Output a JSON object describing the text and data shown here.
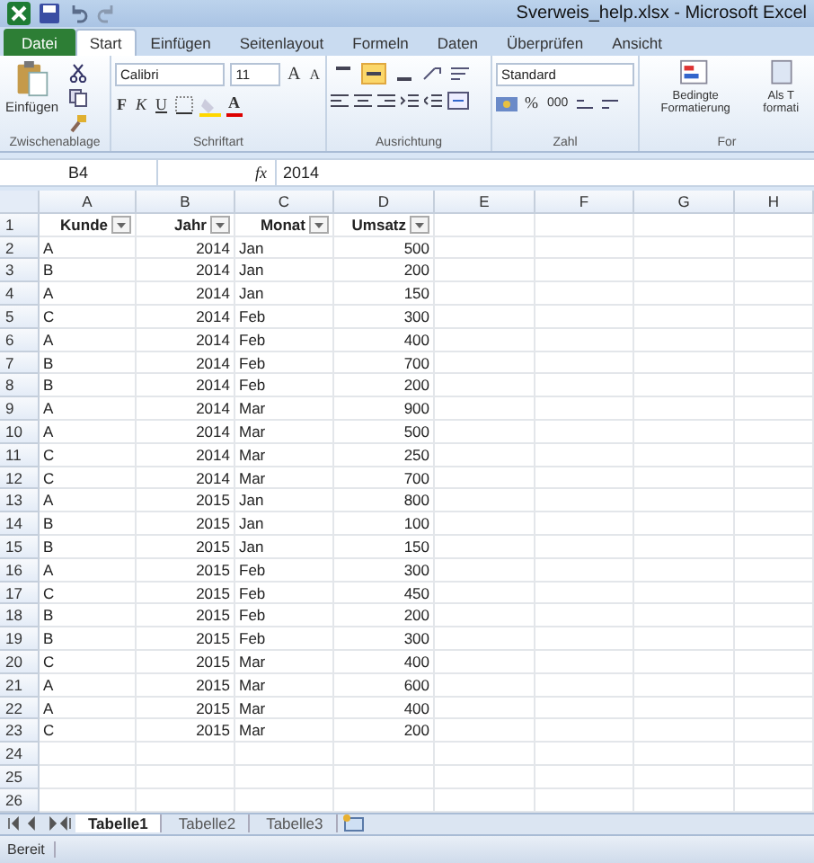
{
  "window": {
    "title": "Sverweis_help.xlsx - Microsoft Excel"
  },
  "ribbon_tabs": [
    {
      "label": "Datei",
      "kind": "file",
      "selected": false
    },
    {
      "label": "Start",
      "kind": "tab",
      "selected": true
    },
    {
      "label": "Einfügen",
      "kind": "tab",
      "selected": false
    },
    {
      "label": "Seitenlayout",
      "kind": "tab",
      "selected": false
    },
    {
      "label": "Formeln",
      "kind": "tab",
      "selected": false
    },
    {
      "label": "Daten",
      "kind": "tab",
      "selected": false
    },
    {
      "label": "Überprüfen",
      "kind": "tab",
      "selected": false
    },
    {
      "label": "Ansicht",
      "kind": "tab",
      "selected": false
    }
  ],
  "ribbon": {
    "clipboard": {
      "paste_label": "Einfügen",
      "group_label": "Zwischenablage"
    },
    "font": {
      "family": "Calibri",
      "size": "11",
      "grow": "A",
      "shrink": "A",
      "bold": "F",
      "italic": "K",
      "underline": "U",
      "font_color": "A",
      "group_label": "Schriftart"
    },
    "alignment": {
      "vertical": [
        {
          "selected": false
        },
        {
          "selected": true
        },
        {
          "selected": false
        }
      ],
      "group_label": "Ausrichtung"
    },
    "number": {
      "format": "Standard",
      "percent": "%",
      "thousands": "000",
      "group_label": "Zahl"
    },
    "styles": {
      "conditional_label": "Bedingte Formatierung",
      "table_label": "Als T formati",
      "group_label": "For"
    }
  },
  "formula_bar": {
    "name_box": "B4",
    "fx": "fx",
    "value": "2014"
  },
  "sheet": {
    "columns": [
      {
        "letter": "A",
        "kind": "text"
      },
      {
        "letter": "B",
        "kind": "number"
      },
      {
        "letter": "C",
        "kind": "text"
      },
      {
        "letter": "D",
        "kind": "number"
      },
      {
        "letter": "E",
        "kind": "text"
      },
      {
        "letter": "F",
        "kind": "text"
      },
      {
        "letter": "G",
        "kind": "text"
      },
      {
        "letter": "H",
        "kind": "text"
      }
    ],
    "rows": [
      {
        "number": "1",
        "kind": "header",
        "cells": [
          "Kunde",
          "Jahr",
          "Monat",
          "Umsatz"
        ]
      },
      {
        "number": "2",
        "kind": "data",
        "cells": [
          "A",
          "2014",
          "Jan",
          "500"
        ]
      },
      {
        "number": "3",
        "kind": "data",
        "cells": [
          "B",
          "2014",
          "Jan",
          "200"
        ]
      },
      {
        "number": "4",
        "kind": "data",
        "cells": [
          "A",
          "2014",
          "Jan",
          "150"
        ]
      },
      {
        "number": "5",
        "kind": "data",
        "cells": [
          "C",
          "2014",
          "Feb",
          "300"
        ]
      },
      {
        "number": "6",
        "kind": "data",
        "cells": [
          "A",
          "2014",
          "Feb",
          "400"
        ]
      },
      {
        "number": "7",
        "kind": "data",
        "cells": [
          "B",
          "2014",
          "Feb",
          "700"
        ]
      },
      {
        "number": "8",
        "kind": "data",
        "cells": [
          "B",
          "2014",
          "Feb",
          "200"
        ]
      },
      {
        "number": "9",
        "kind": "data",
        "cells": [
          "A",
          "2014",
          "Mar",
          "900"
        ]
      },
      {
        "number": "10",
        "kind": "data",
        "cells": [
          "A",
          "2014",
          "Mar",
          "500"
        ]
      },
      {
        "number": "11",
        "kind": "data",
        "cells": [
          "C",
          "2014",
          "Mar",
          "250"
        ]
      },
      {
        "number": "12",
        "kind": "data",
        "cells": [
          "C",
          "2014",
          "Mar",
          "700"
        ]
      },
      {
        "number": "13",
        "kind": "data",
        "cells": [
          "A",
          "2015",
          "Jan",
          "800"
        ]
      },
      {
        "number": "14",
        "kind": "data",
        "cells": [
          "B",
          "2015",
          "Jan",
          "100"
        ]
      },
      {
        "number": "15",
        "kind": "data",
        "cells": [
          "B",
          "2015",
          "Jan",
          "150"
        ]
      },
      {
        "number": "16",
        "kind": "data",
        "cells": [
          "A",
          "2015",
          "Feb",
          "300"
        ]
      },
      {
        "number": "17",
        "kind": "data",
        "cells": [
          "C",
          "2015",
          "Feb",
          "450"
        ]
      },
      {
        "number": "18",
        "kind": "data",
        "cells": [
          "B",
          "2015",
          "Feb",
          "200"
        ]
      },
      {
        "number": "19",
        "kind": "data",
        "cells": [
          "B",
          "2015",
          "Feb",
          "300"
        ]
      },
      {
        "number": "20",
        "kind": "data",
        "cells": [
          "C",
          "2015",
          "Mar",
          "400"
        ]
      },
      {
        "number": "21",
        "kind": "data",
        "cells": [
          "A",
          "2015",
          "Mar",
          "600"
        ]
      },
      {
        "number": "22",
        "kind": "data",
        "cells": [
          "A",
          "2015",
          "Mar",
          "400"
        ]
      },
      {
        "number": "23",
        "kind": "data",
        "cells": [
          "C",
          "2015",
          "Mar",
          "200"
        ]
      },
      {
        "number": "24",
        "kind": "data"
      },
      {
        "number": "25",
        "kind": "data"
      },
      {
        "number": "26",
        "kind": "data"
      }
    ]
  },
  "sheet_tabs": [
    {
      "label": "Tabelle1",
      "selected": true
    },
    {
      "label": "Tabelle2",
      "selected": false
    },
    {
      "label": "Tabelle3",
      "selected": false
    }
  ],
  "status_bar": {
    "text": "Bereit"
  }
}
